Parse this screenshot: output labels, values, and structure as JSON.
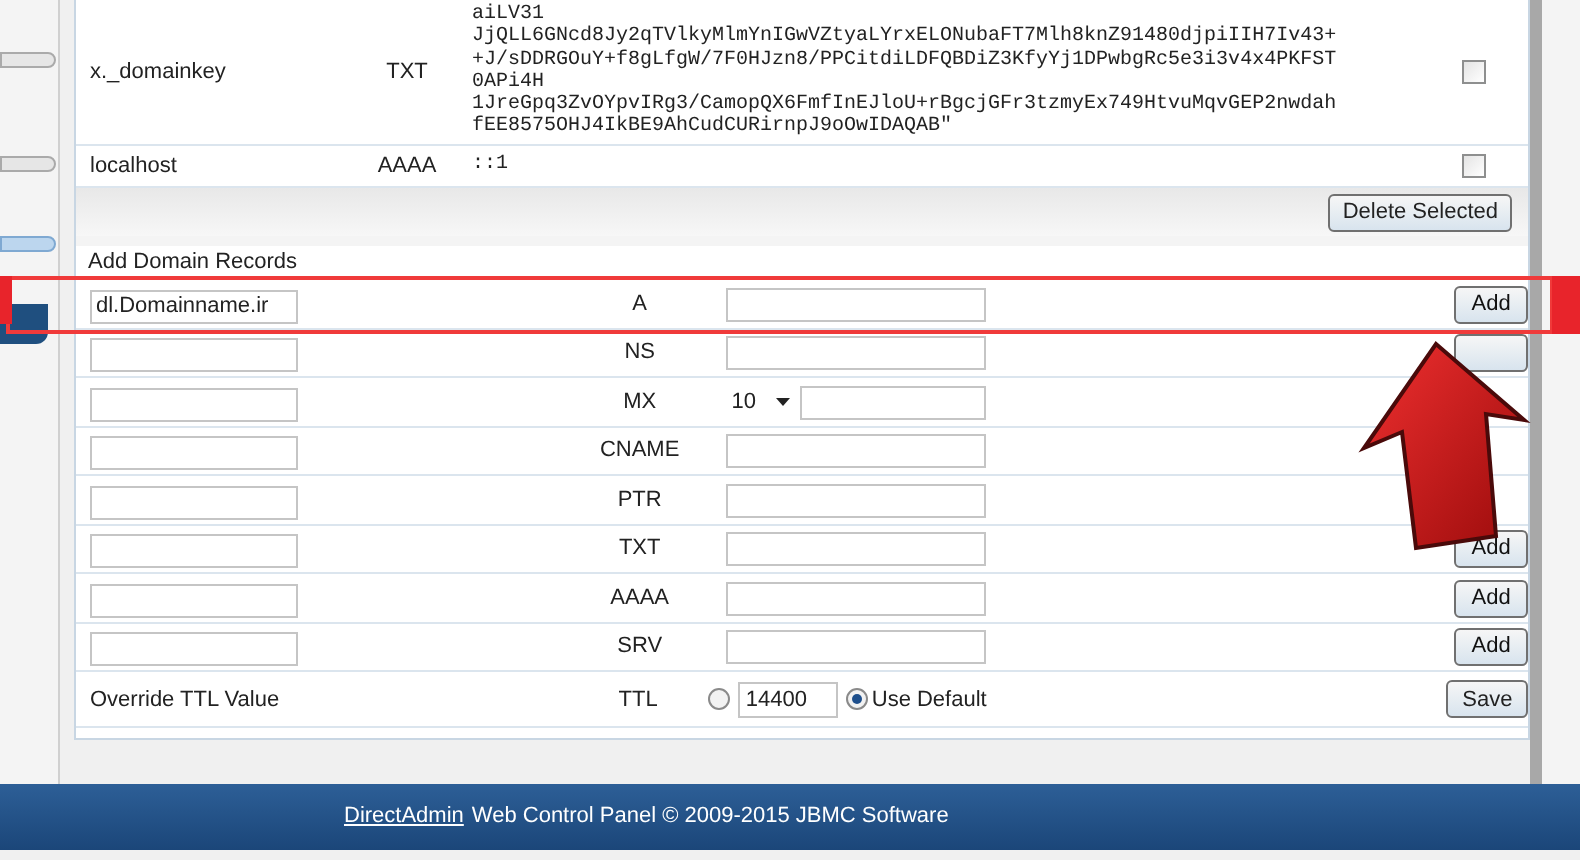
{
  "records": [
    {
      "name": "x._domainkey",
      "type": "TXT",
      "value_lines": [
        "aiLV31",
        "JjQLL6GNcd8Jy2qTVlkyMlmYnIGwVZtyaLYrxELONubaFT7Mlh8knZ91480djpiIIH7Iv43+",
        "+J/sDDRGOuY+f8gLfgW/7F0HJzn8/PPCitdiLDFQBDiZ3KfyYj1DPwbgRc5e3i3v4x4PKFST",
        "0APi4H",
        "1JreGpq3ZvOYpvIRg3/CamopQX6FmfInEJloU+rBgcjGFr3tzmyEx749HtvuMqvGEP2nwdah",
        "fEE8575OHJ4IkBE9AhCudCURirnpJ9oOwIDAQAB\""
      ],
      "checked": false
    },
    {
      "name": "localhost",
      "type": "AAAA",
      "value_lines": [
        "::1"
      ],
      "checked": false
    }
  ],
  "delete_button": "Delete Selected",
  "add_section": {
    "title": "Add Domain Records",
    "rows": [
      {
        "kind": "plain",
        "name_value": "dl.Domainname.ir",
        "type": "A",
        "button": "Add"
      },
      {
        "kind": "plain",
        "type": "NS",
        "covered_button": true
      },
      {
        "kind": "mx",
        "type": "MX",
        "priority": "10"
      },
      {
        "kind": "plain",
        "type": "CNAME"
      },
      {
        "kind": "plain",
        "type": "PTR"
      },
      {
        "kind": "plain",
        "type": "TXT",
        "button": "Add"
      },
      {
        "kind": "plain",
        "type": "AAAA",
        "button": "Add"
      },
      {
        "kind": "plain",
        "type": "SRV",
        "button": "Add"
      }
    ]
  },
  "ttl": {
    "label": "Override TTL Value",
    "type": "TTL",
    "value": "14400",
    "options": [
      {
        "selected": false
      },
      {
        "label": "Use Default",
        "selected": true
      }
    ],
    "button": "Save"
  },
  "footer": {
    "link": "DirectAdmin",
    "text": "Web Control Panel © 2009-2015 JBMC Software"
  }
}
